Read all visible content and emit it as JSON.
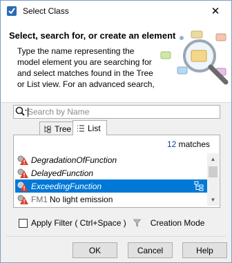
{
  "window": {
    "title": "Select Class",
    "close_glyph": "✕"
  },
  "banner": {
    "heading": "Select, search for, or create an element",
    "description_lines": [
      "Type the name representing the",
      "model element you are searching for",
      "and select matches found in the Tree",
      "or List view. For an advanced search,"
    ]
  },
  "search": {
    "placeholder": "Search by Name",
    "value": "",
    "icon": "search-icon"
  },
  "tabs": [
    {
      "label": "Tree",
      "icon": "tree-icon",
      "active": false
    },
    {
      "label": "List",
      "icon": "list-icon",
      "active": true
    }
  ],
  "results": {
    "count": "12",
    "count_suffix": "matches",
    "items": [
      {
        "label": "DegradationOfFunction",
        "icon": "class-warning-icon",
        "selected": false
      },
      {
        "label": "DelayedFunction",
        "icon": "class-warning-icon",
        "selected": false
      },
      {
        "label": "ExceedingFunction",
        "icon": "class-warning-icon",
        "selected": true
      },
      {
        "tag": "FM1",
        "label": "No light emission",
        "icon": "class-warning-icon",
        "selected": false
      }
    ]
  },
  "filter": {
    "label": "Apply Filter ( Ctrl+Space )",
    "checked": false,
    "mode_label": "Creation Mode"
  },
  "buttons": {
    "ok": "OK",
    "cancel": "Cancel",
    "help": "Help"
  },
  "colors": {
    "selection": "#0078d7",
    "count": "#1a3c9e",
    "warning": "#d9412b"
  }
}
